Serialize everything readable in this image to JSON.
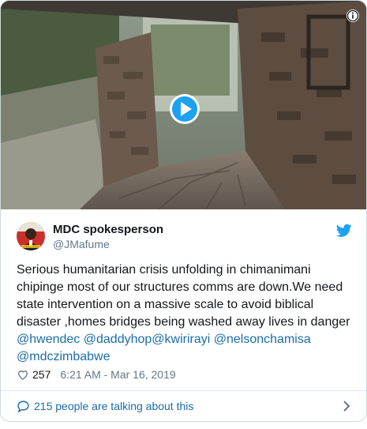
{
  "tweet": {
    "author_name": "MDC spokesperson",
    "author_handle": "@JMafume",
    "text_parts": {
      "body": "Serious humanitarian crisis unfolding in chimanimani chipinge most of our structures comms are down.We need state intervention on a massive scale to avoid biblical disaster ,homes bridges being washed away lives in danger ",
      "m1": "@hwendec",
      "m2": "@daddyhop",
      "m3": "@kwirirayi",
      "m4": "@nelsonchamisa",
      "m5": "@mdczimbabwe"
    },
    "likes": "257",
    "timestamp": "6:21 AM - Mar 16, 2019",
    "talking_label": "215 people are talking about this"
  },
  "colors": {
    "brand_blue": "#1da1f2",
    "link_blue": "#1b6ca8",
    "muted": "#657786"
  },
  "icons": [
    "info-icon",
    "play-icon",
    "twitter-bird-icon",
    "heart-icon",
    "speech-bubble-icon",
    "chevron-right-icon"
  ]
}
